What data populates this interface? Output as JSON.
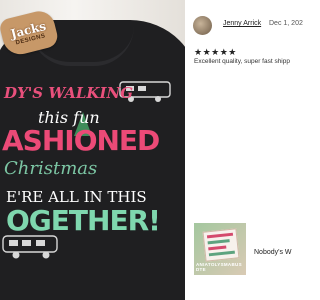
{
  "photo": {
    "tag": {
      "line1": "Jacks",
      "line2": "DESIGNS"
    },
    "print_lines": [
      "DY'S WALKING",
      "this fun",
      "ASHIONED",
      "Christmas",
      "E'RE ALL IN THIS",
      "OGETHER!"
    ]
  },
  "review": {
    "reviewer_name": "Jenny Arrick",
    "date": "Dec 1, 202",
    "rating": 5,
    "stars": "★★★★★",
    "text": "Excellent quality, super fast shipp",
    "item_thumbnail_caption": "ANIATOLYSMABUS DTE",
    "item_title": "Nobody's W"
  },
  "colors": {
    "shirt": "#1f1f21",
    "print_pink": "#e9507c",
    "print_green": "#7fd7ae",
    "tag_brown": "#c79868"
  }
}
